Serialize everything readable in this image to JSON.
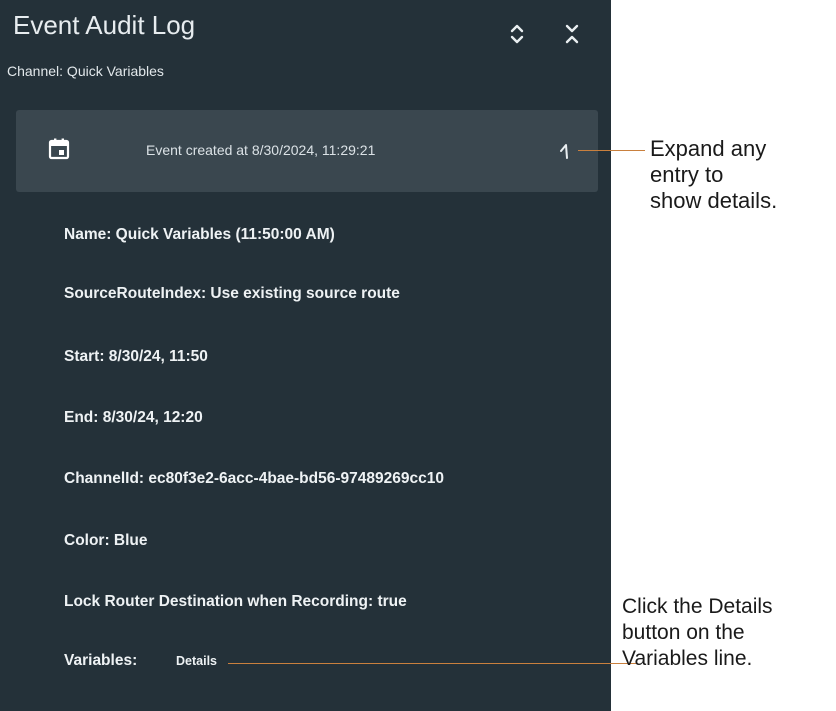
{
  "header": {
    "title": "Event Audit Log",
    "channel": "Channel: Quick Variables",
    "icons": [
      "unfold-more-icon",
      "unfold-less-icon"
    ]
  },
  "event": {
    "summary": "Event created at 8/30/2024, 11:29:21",
    "icon": "calendar-icon",
    "expanded": true
  },
  "details": [
    "Name: Quick Variables (11:50:00 AM)",
    "SourceRouteIndex: Use existing source route",
    "Start: 8/30/24, 11:50",
    "End: 8/30/24, 12:20",
    "ChannelId: ec80f3e2-6acc-4bae-bd56-97489269cc10",
    "Color: Blue",
    "Lock Router Destination when Recording: true"
  ],
  "variables": {
    "label": "Variables:",
    "button_label": "Details"
  },
  "callouts": {
    "expand_lines": [
      "Expand any",
      "entry to",
      "show details."
    ],
    "details_lines": [
      "Click the Details",
      "button on the",
      "Variables line."
    ]
  },
  "colors": {
    "panel_bg": "#243139",
    "row_bg": "#3a474f",
    "callout_line": "#c9803e"
  }
}
